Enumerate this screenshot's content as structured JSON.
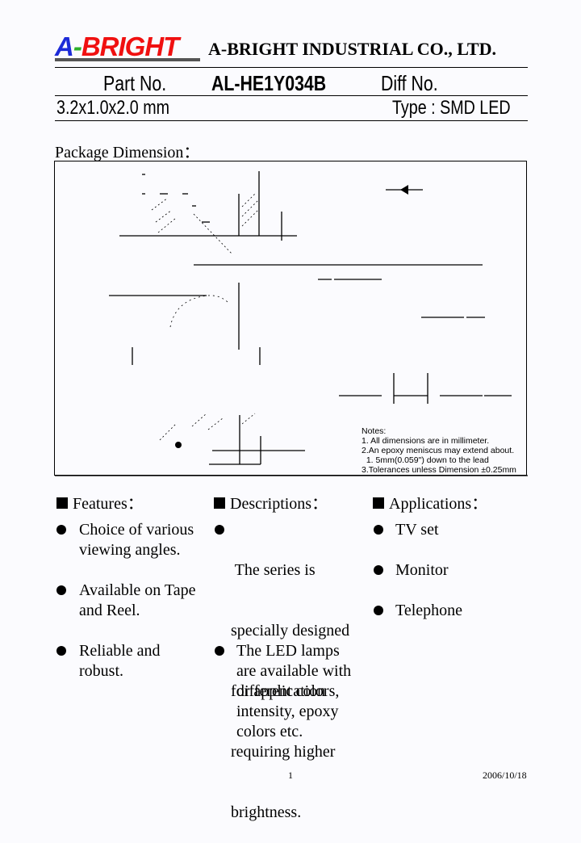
{
  "header": {
    "logo": {
      "part_a": "A",
      "part_dash": "-",
      "part_rest": "BRIGHT",
      "colors": {
        "a": "#1d2bd8",
        "dash": "#2cb02a",
        "rest": "#f01010"
      }
    },
    "company_name": "A-BRIGHT INDUSTRIAL CO., LTD."
  },
  "part_info": {
    "part_no_label": "Part No.",
    "part_no_value": "AL-HE1Y034B",
    "diff_no_label": "Diff No.",
    "dimensions": "3.2x1.0x2.0 mm",
    "type": "Type : SMD LED"
  },
  "package_dimension": {
    "title": "Package Dimension：",
    "notes": [
      "Notes:",
      "1. All dimensions are in millimeter.",
      "2.An epoxy meniscus may extend about.",
      "  1. 5mm(0.059\") down to the lead",
      "3.Tolerances unless Dimension ±0.25mm"
    ]
  },
  "sections": {
    "features": {
      "title": "Features：",
      "items": [
        [
          "Choice of various",
          "viewing angles."
        ],
        [
          "Available on Tape",
          "and Reel."
        ],
        [
          "Reliable and",
          "robust."
        ]
      ]
    },
    "descriptions": {
      "title": "Descriptions：",
      "items": [
        [
          " The series is",
          "specially designed",
          "for application",
          "requiring higher",
          "brightness."
        ],
        [
          "The LED lamps",
          "are available with",
          "different colors,",
          "intensity, epoxy",
          "colors etc."
        ]
      ]
    },
    "applications": {
      "title": "Applications：",
      "items": [
        [
          "TV set"
        ],
        [
          "Monitor"
        ],
        [
          "Telephone"
        ]
      ]
    }
  },
  "footer": {
    "page": "1",
    "date": "2006/10/18"
  }
}
